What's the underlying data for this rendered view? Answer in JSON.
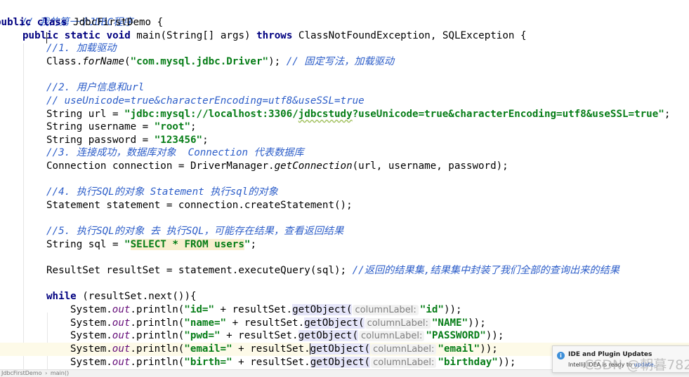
{
  "editor": {
    "file_comment": "// 我的第一个JDBC程序",
    "class_decl": {
      "kw1": "public",
      "kw2": "class",
      "name": " JdbcFirstDemo {"
    },
    "main_decl": {
      "kw1": "public",
      "kw2": "static",
      "kw3": "void",
      "sig": " main(String[] args) ",
      "kw4": "throws",
      "rest": " ClassNotFoundException, SQLException {"
    },
    "step1": {
      "comment": "//1. 加载驱动",
      "code_a": "Class.",
      "code_method": "forName",
      "code_b": "(",
      "code_str": "\"com.mysql.jdbc.Driver\"",
      "code_c": "); ",
      "trailing_comment": "// 固定写法，加载驱动"
    },
    "step2": {
      "comment": "//2. 用户信息和url",
      "comment2": "// useUnicode=true&characterEncoding=utf8&useSSL=true",
      "url_a": "String url = ",
      "url_str_a": "\"jdbc:mysql://localhost:3306/",
      "url_str_squiggle": "jdbcstudy",
      "url_str_b": "?useUnicode=true&characterEncoding=utf8&useSSL=true\"",
      "url_end": ";",
      "user_a": "String username = ",
      "user_str": "\"root\"",
      "user_end": ";",
      "pass_a": "String password = ",
      "pass_str": "\"123456\"",
      "pass_end": ";"
    },
    "step3": {
      "comment": "//3. 连接成功，数据库对象  Connection 代表数据库",
      "code_a": "Connection connection = DriverManager.",
      "code_method": "getConnection",
      "code_b": "(url, username, password);"
    },
    "step4": {
      "comment": "//4. 执行SQL的对象 Statement 执行sql的对象",
      "code": "Statement statement = connection.createStatement();"
    },
    "step5": {
      "comment": "//5. 执行SQL的对象 去 执行SQL，可能存在结果，查看返回结果",
      "sql_a": "String sql = ",
      "sql_q1": "\"",
      "sql_hl": "SELECT * FROM users",
      "sql_q2": "\"",
      "sql_end": ";",
      "rs_code": "ResultSet resultSet = statement.executeQuery(sql); ",
      "rs_comment": "//返回的结果集,结果集中封装了我们全部的查询出来的结果"
    },
    "loop": {
      "kw": "while",
      "cond": " (resultSet.next()){",
      "prints": [
        {
          "prefix": "System.",
          "field": "out",
          "mid": ".println(",
          "str": "\"id=\"",
          "plus": " + resultSet.",
          "call": "getObject(",
          "hint": "columnLabel:",
          "arg": "\"id\"",
          "end": "));"
        },
        {
          "prefix": "System.",
          "field": "out",
          "mid": ".println(",
          "str": "\"name=\"",
          "plus": " + resultSet.",
          "call": "getObject(",
          "hint": "columnLabel:",
          "arg": "\"NAME\"",
          "end": "));"
        },
        {
          "prefix": "System.",
          "field": "out",
          "mid": ".println(",
          "str": "\"pwd=\"",
          "plus": " + resultSet.",
          "call": "getObject(",
          "hint": "columnLabel:",
          "arg": "\"PASSWORD\"",
          "end": "));"
        },
        {
          "prefix": "System.",
          "field": "out",
          "mid": ".println(",
          "str": "\"email=\"",
          "plus": " + resultSet.",
          "call": "getObject(",
          "hint": "columnLabel:",
          "arg": "\"email\"",
          "end": "));"
        },
        {
          "prefix": "System.",
          "field": "out",
          "mid": ".println(",
          "str": "\"birth=\"",
          "plus": " + resultSet.",
          "call": "getObject(",
          "hint": "columnLabel:",
          "arg": "\"birthday\"",
          "end": "));"
        }
      ]
    }
  },
  "breadcrumb": {
    "items": [
      "JdbcFirstDemo",
      "main()"
    ],
    "separator": "›"
  },
  "notification": {
    "title": "IDE and Plugin Updates",
    "body": "IntelliJ IDEA is ready to ",
    "link": "update."
  },
  "watermark": "CSDN @朝暮782"
}
